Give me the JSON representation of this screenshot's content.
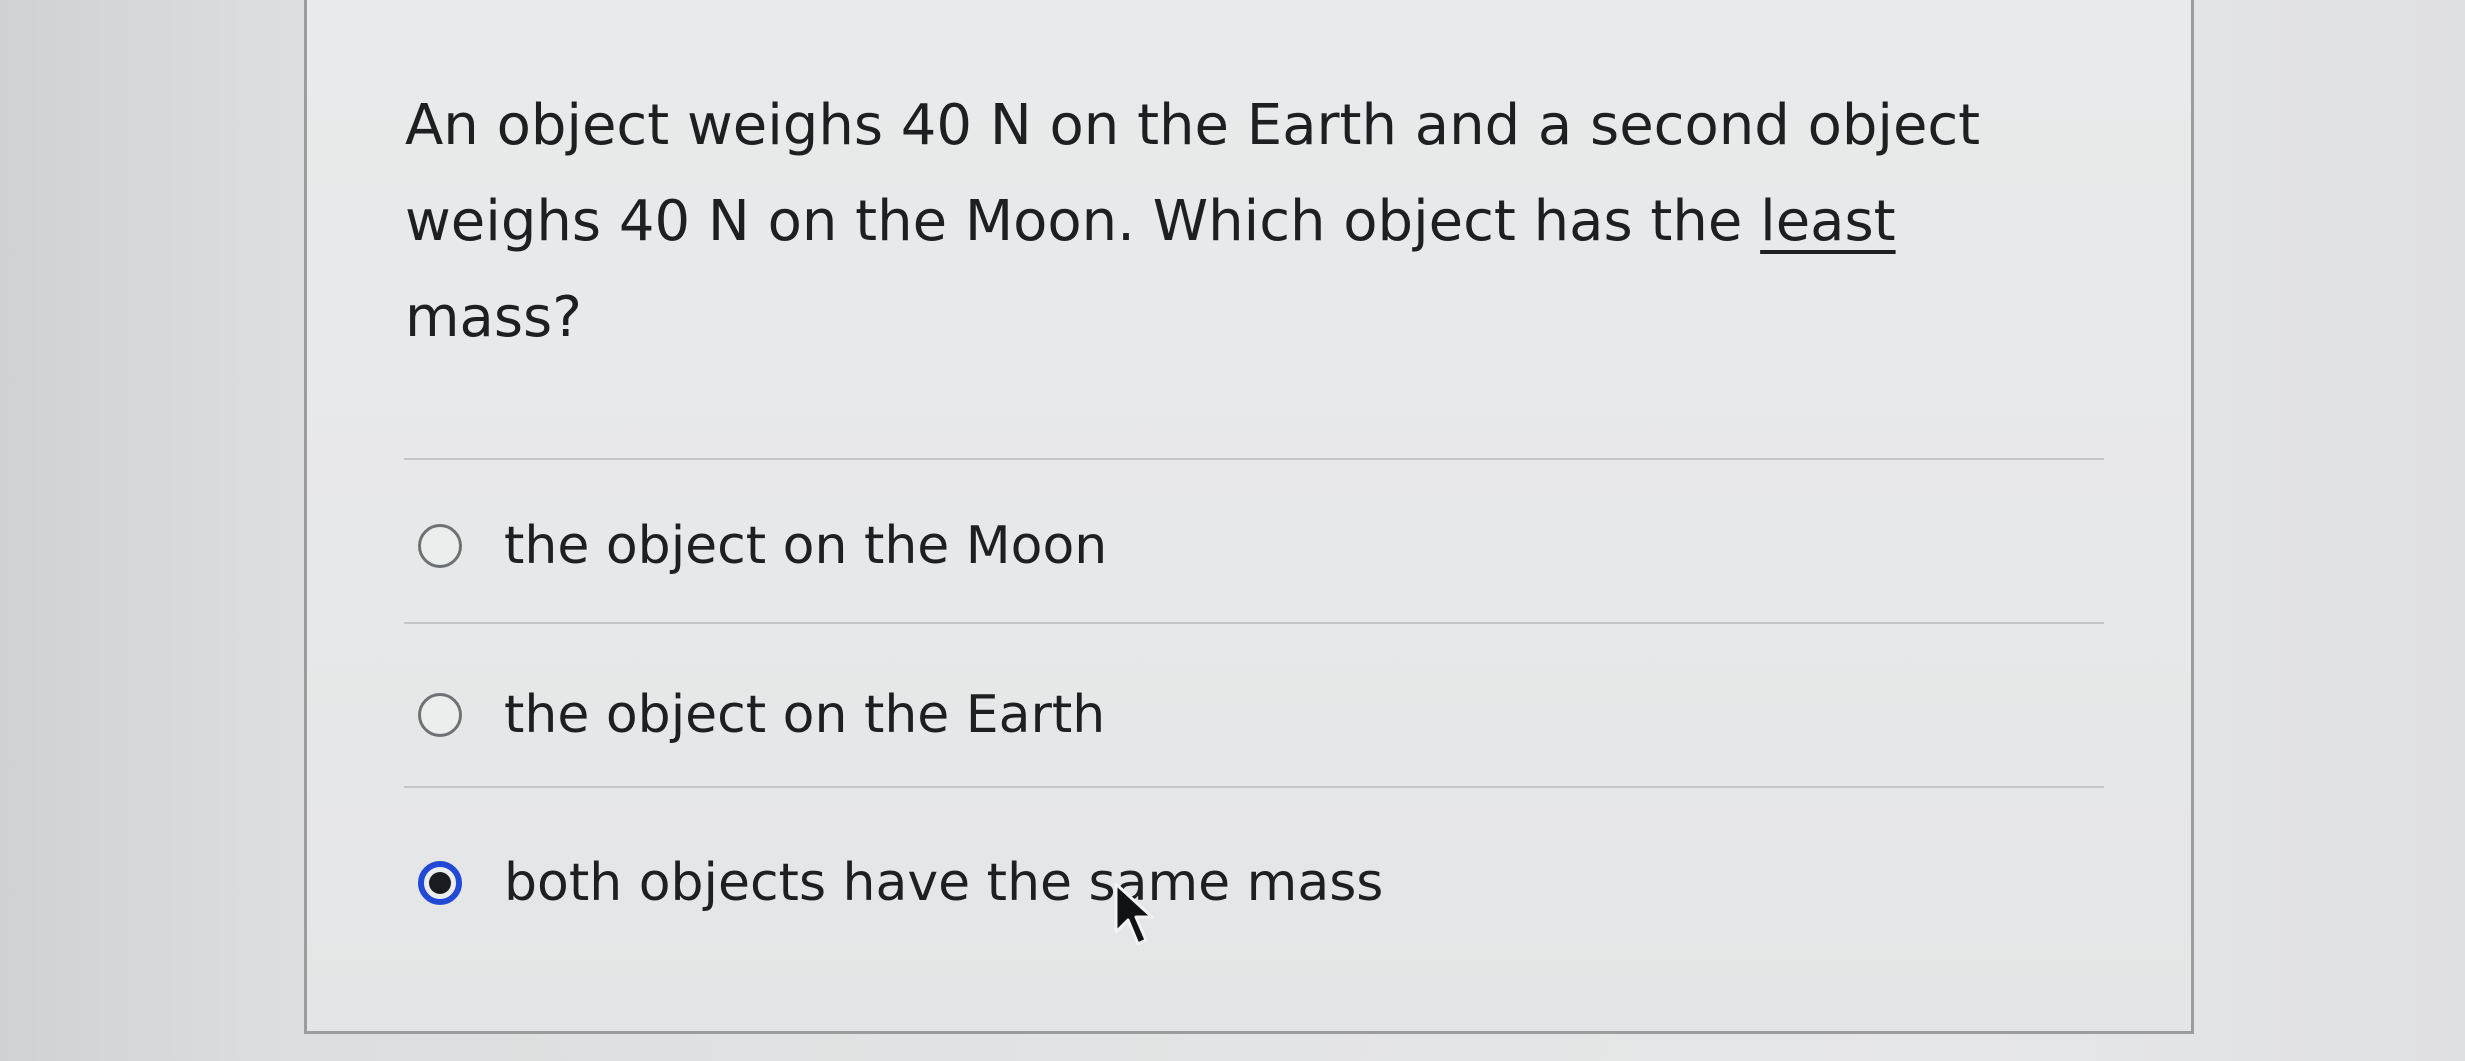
{
  "question": {
    "text_before": "An object weighs 40 N on the Earth and a second object weighs 40 N on the Moon. Which object has the ",
    "emphasized": "least",
    "text_after": " mass?"
  },
  "options": [
    {
      "label": "the object on the Moon",
      "selected": false
    },
    {
      "label": "the object on the Earth",
      "selected": false
    },
    {
      "label": "both objects have the same mass",
      "selected": true
    }
  ],
  "colors": {
    "accent": "#2248d6",
    "text": "#1d1f21",
    "card_border": "#9a9c9e"
  },
  "icons": {
    "pointer": "mouse-pointer-icon"
  }
}
